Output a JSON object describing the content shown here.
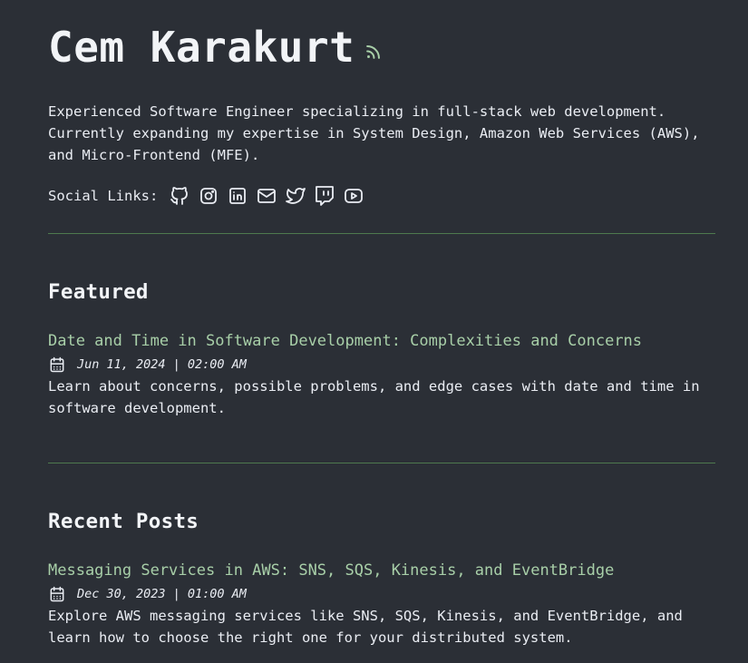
{
  "header": {
    "site_title": "Cem Karakurt",
    "rss_icon": "rss-icon"
  },
  "intro": {
    "text": "Experienced Software Engineer specializing in full-stack web development. Currently expanding my expertise in System Design, Amazon Web Services (AWS), and Micro-Frontend (MFE)."
  },
  "social": {
    "label": "Social Links:",
    "icons": [
      "github-icon",
      "instagram-icon",
      "linkedin-icon",
      "mail-icon",
      "twitter-icon",
      "twitch-icon",
      "youtube-icon"
    ]
  },
  "featured": {
    "heading": "Featured",
    "posts": [
      {
        "title": "Date and Time in Software Development: Complexities and Concerns",
        "date": "Jun 11, 2024 | 02:00 AM",
        "description": "Learn about concerns, possible problems, and edge cases with date and time in software development."
      }
    ]
  },
  "recent": {
    "heading": "Recent Posts",
    "posts": [
      {
        "title": "Messaging Services in AWS: SNS, SQS, Kinesis, and EventBridge",
        "date": "Dec 30, 2023 | 01:00 AM",
        "description": "Explore AWS messaging services like SNS, SQS, Kinesis, and EventBridge, and learn how to choose the right one for your distributed system."
      }
    ]
  },
  "colors": {
    "background": "#2b2f36",
    "accent": "#a8cfa8",
    "rule": "#4e7a4e",
    "text": "#eaedf3"
  }
}
